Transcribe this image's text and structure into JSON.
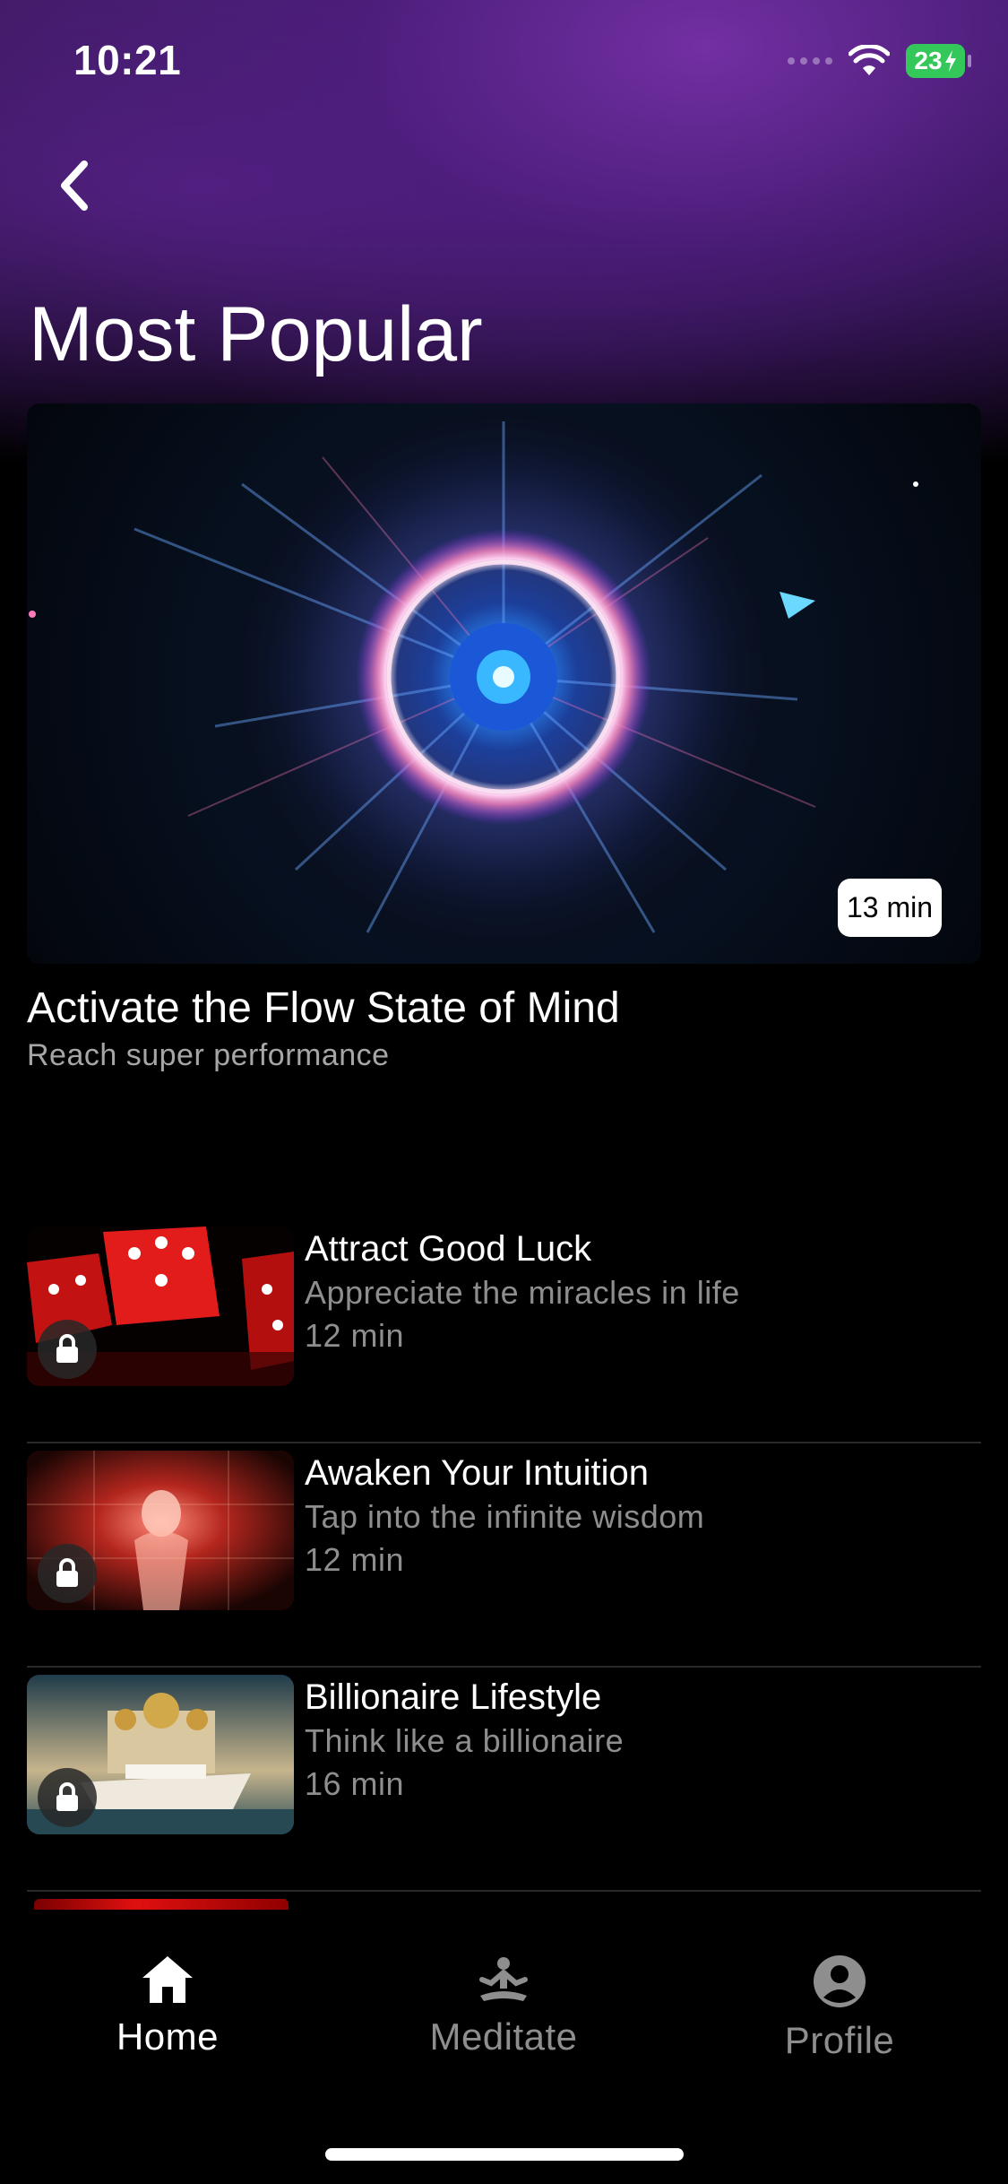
{
  "status_bar": {
    "time": "10:21",
    "battery": "23"
  },
  "page": {
    "title": "Most Popular"
  },
  "featured": {
    "duration": "13 min",
    "title": "Activate the Flow State of Mind",
    "subtitle": "Reach super performance"
  },
  "items": [
    {
      "title": "Attract Good Luck",
      "subtitle": "Appreciate the miracles in life",
      "duration": "12 min",
      "locked": true
    },
    {
      "title": "Awaken Your Intuition",
      "subtitle": "Tap into the infinite wisdom",
      "duration": "12 min",
      "locked": true
    },
    {
      "title": "Billionaire Lifestyle",
      "subtitle": "Think like a billionaire",
      "duration": "16 min",
      "locked": true
    }
  ],
  "tabbar": {
    "home": "Home",
    "meditate": "Meditate",
    "profile": "Profile",
    "active": "home"
  },
  "colors": {
    "background": "#000000",
    "header_purple": "#3a1a5e",
    "battery_green": "#34c759",
    "muted_text": "#8e8e8e",
    "inactive_tab": "#8e8e8e"
  },
  "icons": {
    "back": "chevron-left-icon",
    "wifi": "wifi-icon",
    "lock": "lock-icon",
    "home": "home-icon",
    "meditate": "meditate-icon",
    "profile": "profile-icon"
  }
}
